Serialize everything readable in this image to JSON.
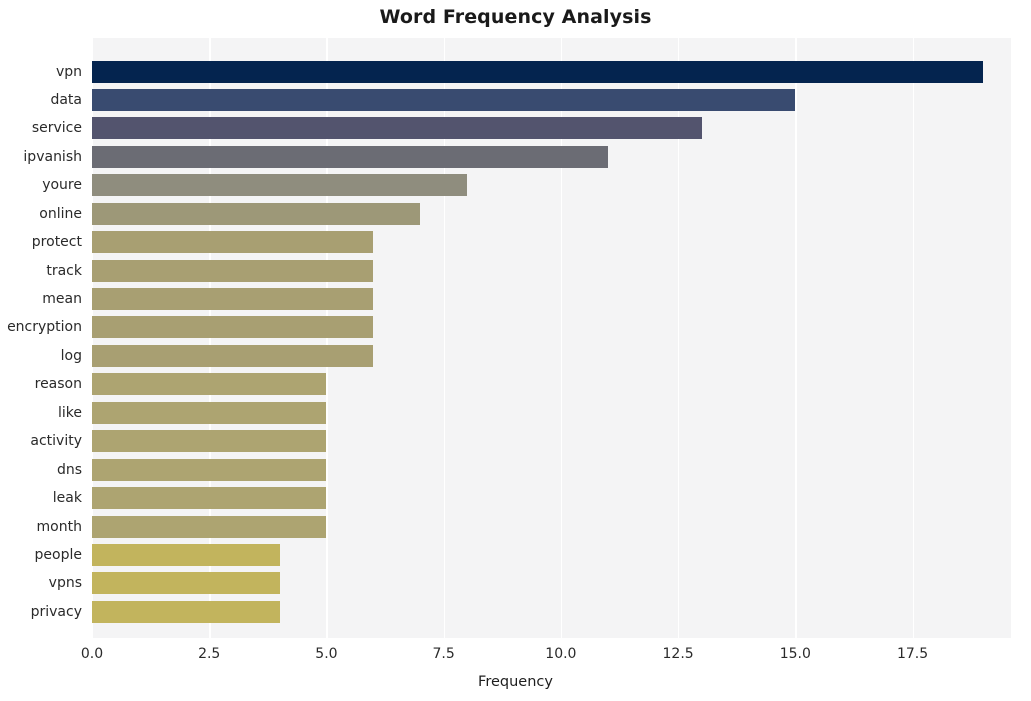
{
  "chart_data": {
    "type": "bar",
    "orientation": "horizontal",
    "title": "Word Frequency Analysis",
    "xlabel": "Frequency",
    "ylabel": "",
    "categories": [
      "vpn",
      "data",
      "service",
      "ipvanish",
      "youre",
      "online",
      "protect",
      "track",
      "mean",
      "encryption",
      "log",
      "reason",
      "like",
      "activity",
      "dns",
      "leak",
      "month",
      "people",
      "vpns",
      "privacy"
    ],
    "values": [
      19,
      15,
      13,
      11,
      8,
      7,
      6,
      6,
      6,
      6,
      6,
      5,
      5,
      5,
      5,
      5,
      5,
      4,
      4,
      4
    ],
    "bar_colors": [
      "#04244f",
      "#394b70",
      "#53546e",
      "#6b6c74",
      "#8f8d7e",
      "#9d9878",
      "#a89f72",
      "#a89f72",
      "#a89f72",
      "#a89f72",
      "#a89f72",
      "#ada471",
      "#ada471",
      "#ada471",
      "#ada471",
      "#ada471",
      "#ada471",
      "#c2b45d",
      "#c2b45d",
      "#c2b45d"
    ],
    "xlim": [
      0,
      19.6
    ],
    "xticks": [
      0.0,
      2.5,
      5.0,
      7.5,
      10.0,
      12.5,
      15.0,
      17.5
    ],
    "xtick_labels": [
      "0.0",
      "2.5",
      "5.0",
      "7.5",
      "10.0",
      "12.5",
      "15.0",
      "17.5"
    ],
    "grid": true,
    "grid_axis": "x",
    "legend": false,
    "plot_background": "#f4f4f5",
    "figure_background": "#ffffff",
    "gridline_color": "#ffffff"
  }
}
